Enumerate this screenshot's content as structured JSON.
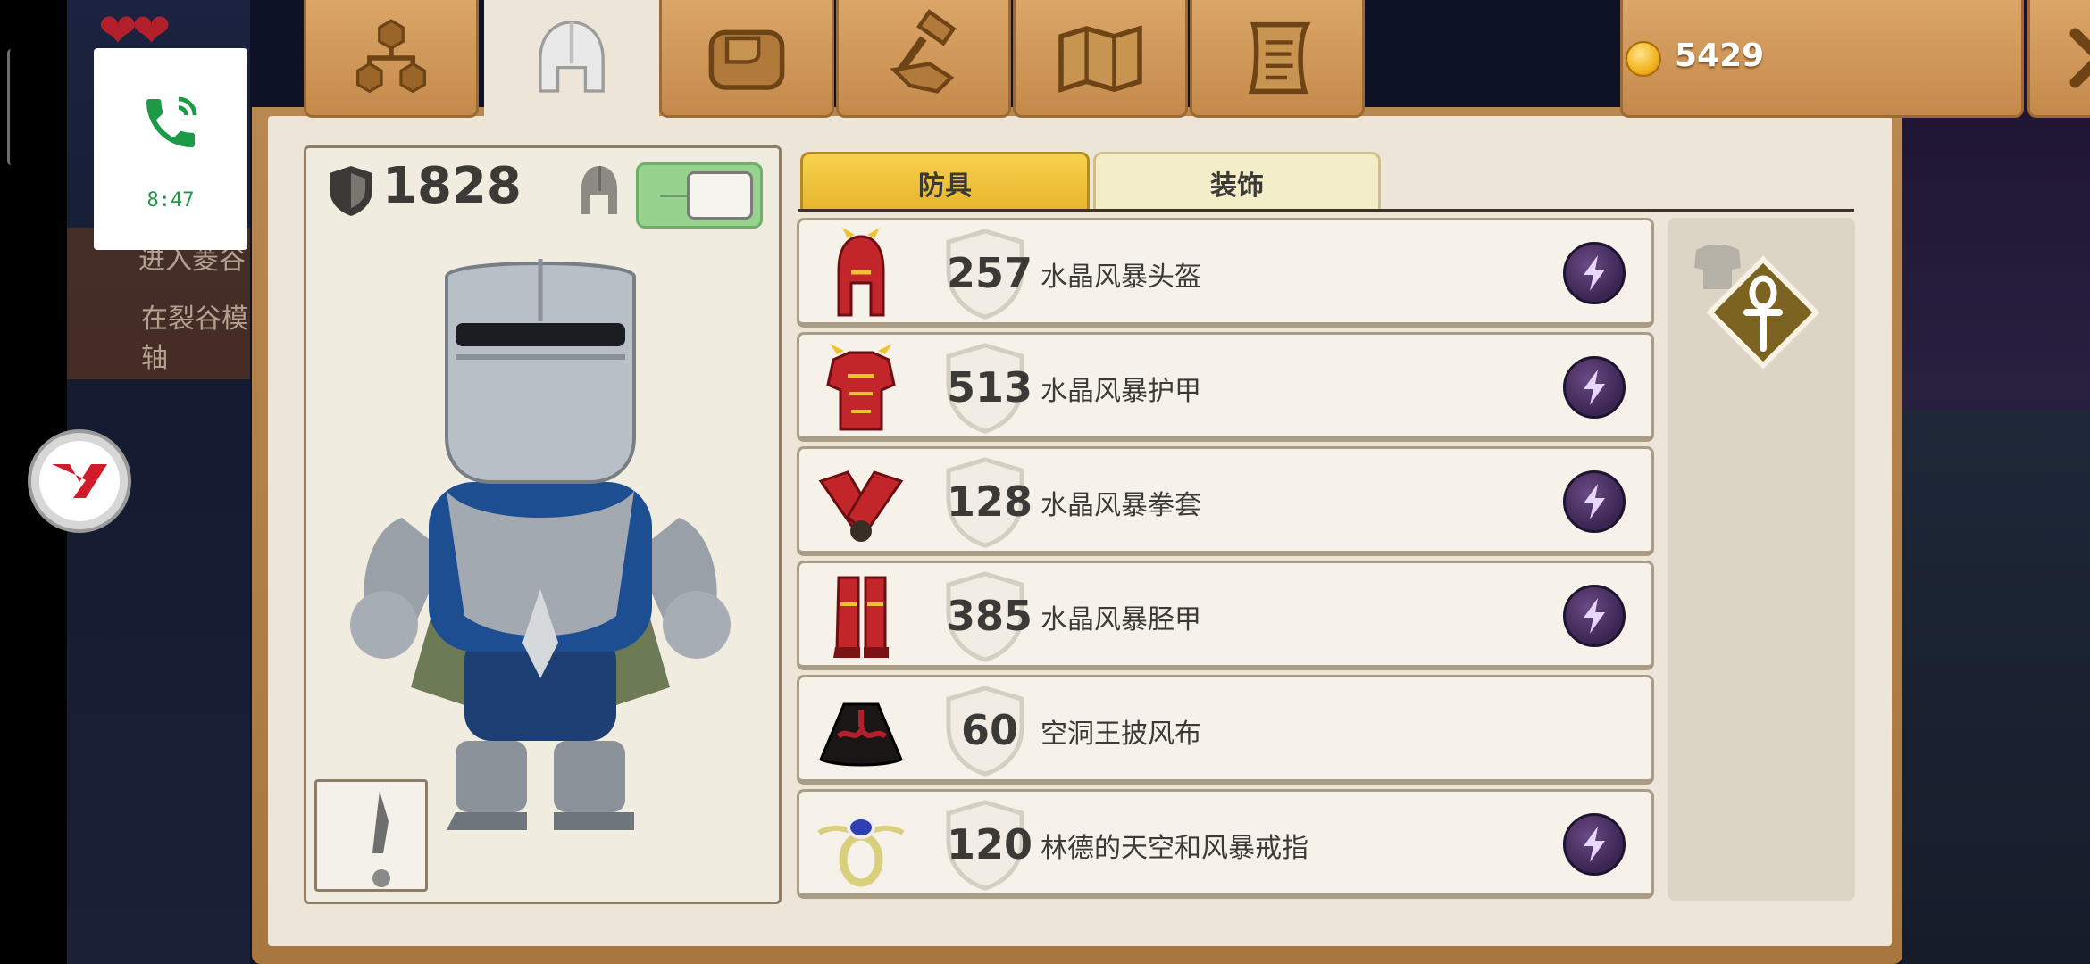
{
  "background": {
    "left_text_line1": "进入菱谷",
    "left_text_line2": "在裂谷模",
    "left_text_line3": "轴"
  },
  "overlay": {
    "call_time": "8:47"
  },
  "header": {
    "tabs": [
      {
        "icon": "skill-tree-icon"
      },
      {
        "icon": "helmet-icon",
        "active": true
      },
      {
        "icon": "bag-icon"
      },
      {
        "icon": "forge-icon"
      },
      {
        "icon": "map-icon"
      },
      {
        "icon": "scroll-icon"
      }
    ],
    "coins": "5429",
    "close_icon": "close-icon"
  },
  "character": {
    "defense": "1828",
    "show_helmet_toggle": true
  },
  "subtabs": {
    "armor": "防具",
    "cosmetic": "装饰"
  },
  "equipment": [
    {
      "value": "257",
      "name": "水晶风暴头盔",
      "icon": "red-helmet-icon",
      "enchant": true
    },
    {
      "value": "513",
      "name": "水晶风暴护甲",
      "icon": "red-chestplate-icon",
      "enchant": true
    },
    {
      "value": "128",
      "name": "水晶风暴拳套",
      "icon": "red-gauntlets-icon",
      "enchant": true
    },
    {
      "value": "385",
      "name": "水晶风暴胫甲",
      "icon": "red-greaves-icon",
      "enchant": true
    },
    {
      "value": "60",
      "name": "空洞王披风布",
      "icon": "black-cape-icon",
      "enchant": false
    },
    {
      "value": "120",
      "name": "林德的天空和风暴戒指",
      "icon": "ring-icon",
      "enchant": true
    }
  ],
  "colors": {
    "wood": "#c48a4b",
    "parchment": "#ede6d8",
    "active_subtab": "#e7b52b",
    "enchant": "#3a2450",
    "toggle_on": "#97d28f"
  }
}
